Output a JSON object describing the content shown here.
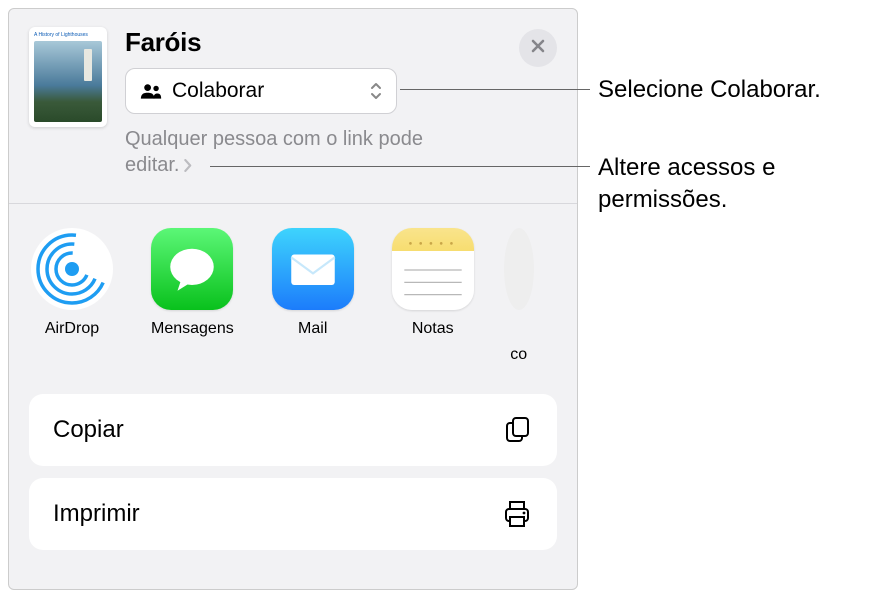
{
  "document": {
    "title": "Faróis",
    "thumbnailTitle": "A History of Lighthouses"
  },
  "collaborate": {
    "label": "Colaborar"
  },
  "permissions": {
    "text": "Qualquer pessoa com o link pode editar."
  },
  "apps": [
    {
      "name": "AirDrop",
      "label": "AirDrop",
      "iconClass": "airdrop-icon"
    },
    {
      "name": "Mensagens",
      "label": "Mensagens",
      "iconClass": "messages-icon"
    },
    {
      "name": "Mail",
      "label": "Mail",
      "iconClass": "mail-icon"
    },
    {
      "name": "Notas",
      "label": "Notas",
      "iconClass": "notes-icon"
    }
  ],
  "partialAppLabel": "co",
  "actions": {
    "copy": "Copiar",
    "print": "Imprimir"
  },
  "callouts": {
    "selectCollab": "Selecione Colaborar.",
    "changePerms": "Altere acessos e permissões."
  }
}
